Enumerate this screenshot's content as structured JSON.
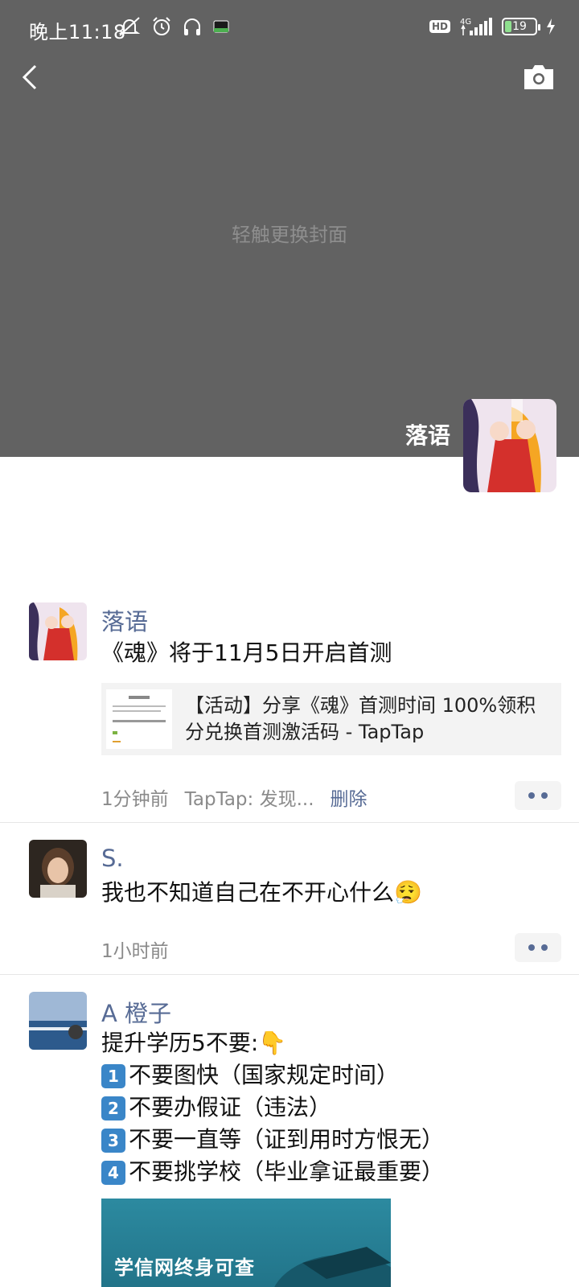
{
  "status_bar": {
    "time": "晚上11:18",
    "hd_label": "HD",
    "network_label": "4G",
    "battery_level": "19"
  },
  "cover": {
    "hint": "轻触更换封面"
  },
  "profile": {
    "name": "落语"
  },
  "posts": [
    {
      "author": "落语",
      "text": "《魂》将于11月5日开启首测",
      "link_title": "【活动】分享《魂》首测时间 100%领积分兑换首测激活码 - TapTap",
      "time": "1分钟前",
      "source": "TapTap: 发现...",
      "delete_label": "删除"
    },
    {
      "author": "S.",
      "text": "我也不知道自己在不开心什么😮‍💨",
      "time": "1小时前"
    },
    {
      "author": "A  橙子",
      "lines": [
        "提升学历5不要:👇",
        "不要图快（国家规定时间）",
        "不要办假证（违法）",
        "不要一直等（证到用时方恨无）",
        "不要挑学校（毕业拿证最重要）"
      ],
      "keycaps": [
        "1",
        "2",
        "3",
        "4"
      ],
      "image_text": "学信网终身可查"
    }
  ],
  "colors": {
    "cover_bg": "#626262",
    "link_blue": "#576b95"
  }
}
